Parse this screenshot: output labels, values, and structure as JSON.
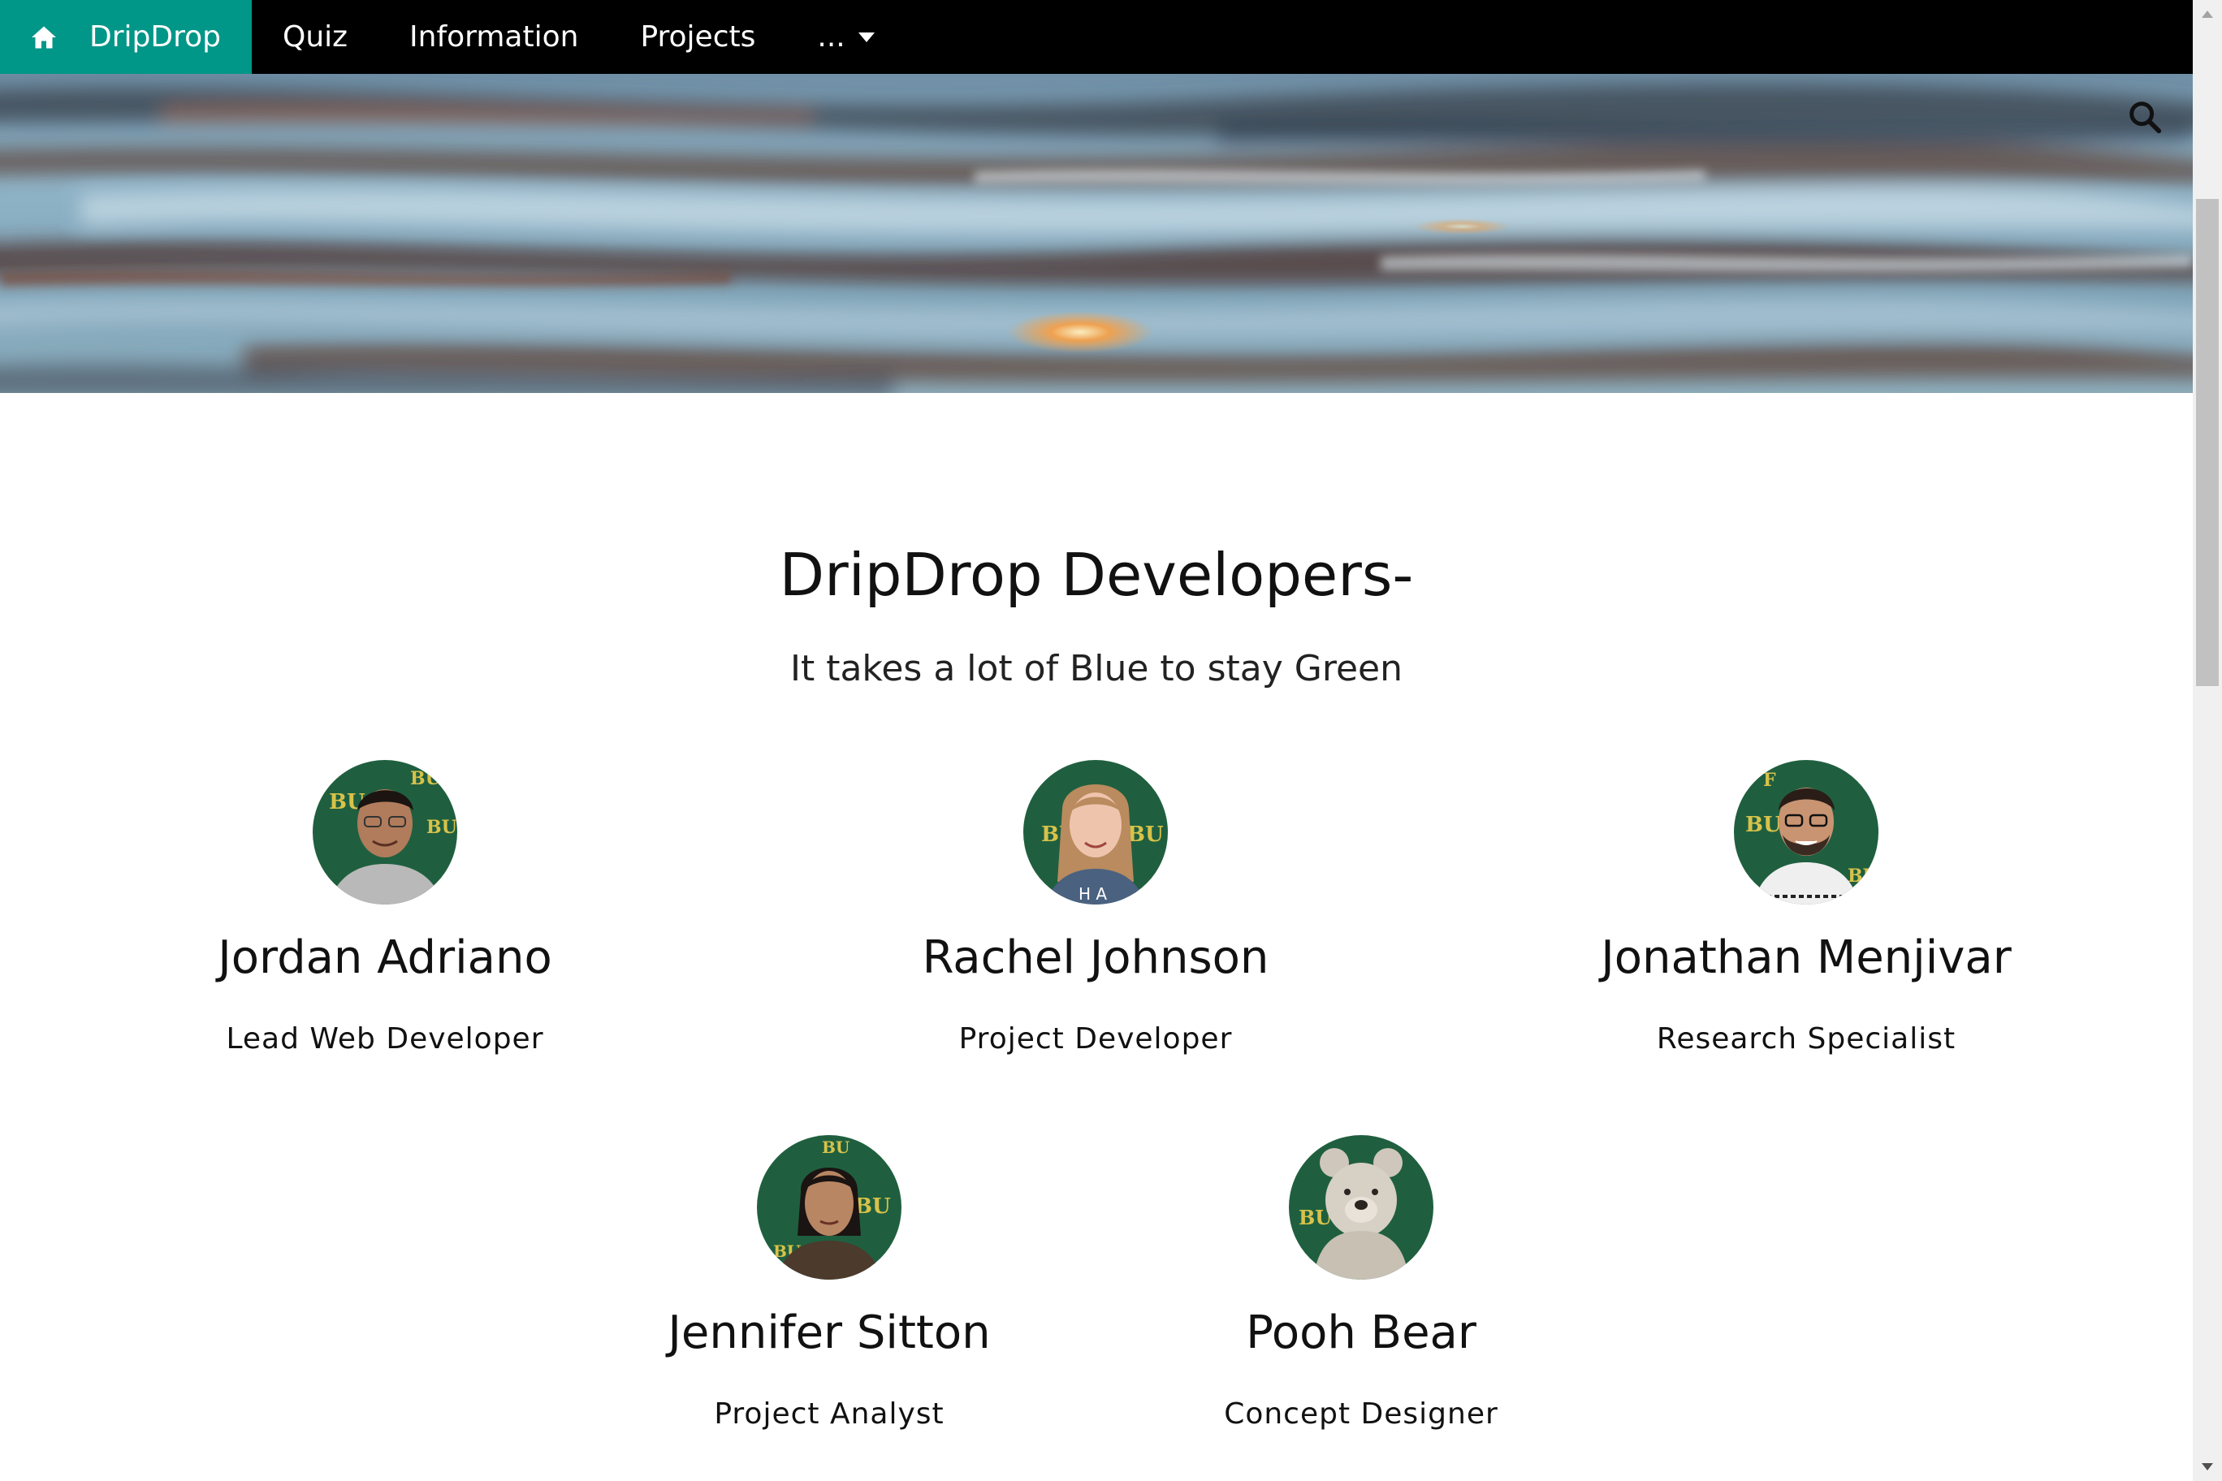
{
  "nav": {
    "brand": "DripDrop",
    "brand_icon": "home-icon",
    "items": [
      {
        "label": "Quiz"
      },
      {
        "label": "Information"
      },
      {
        "label": "Projects"
      },
      {
        "label": "..."
      }
    ]
  },
  "header": {
    "search_icon": "search-icon"
  },
  "content": {
    "title": "DripDrop Developers-",
    "subtitle": "It takes a lot of Blue to stay Green",
    "team": [
      {
        "name": "Jordan Adriano",
        "role": "Lead Web Developer"
      },
      {
        "name": "Rachel Johnson",
        "role": "Project Developer"
      },
      {
        "name": "Jonathan Menjivar",
        "role": "Research Specialist"
      },
      {
        "name": "Jennifer Sitton",
        "role": "Project Analyst"
      },
      {
        "name": "Pooh Bear",
        "role": "Concept Designer"
      }
    ]
  },
  "colors": {
    "brand_accent": "#009688",
    "navbar_bg": "#000000",
    "avatar_bg": "#1f5f3f"
  }
}
